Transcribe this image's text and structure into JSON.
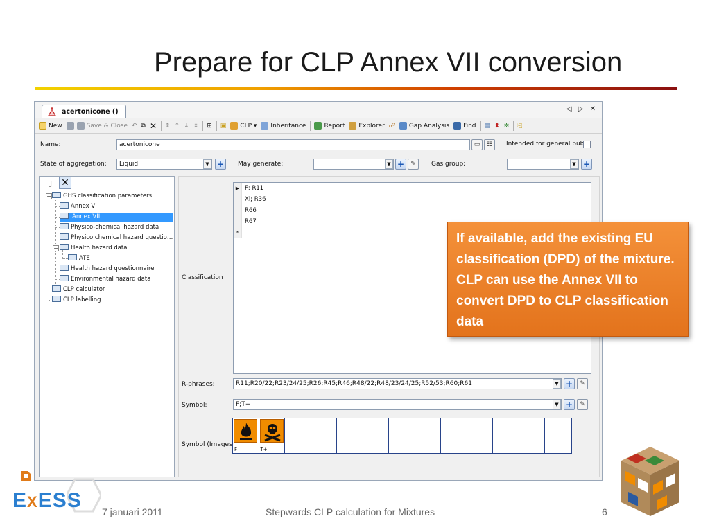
{
  "slide": {
    "title": "Prepare for CLP Annex VII conversion",
    "footer_date": "7 januari 2011",
    "footer_center": "Stepwards CLP calculation for Mixtures",
    "page_number": "6",
    "logo_text": "EXESS",
    "logo_x_color": "#e07b1a",
    "logo_main_color": "#2b7fd0"
  },
  "app": {
    "tab_title": "acertonicone ()",
    "tab_controls": "◁ ▷ ✕",
    "toolbar": [
      {
        "label": "New",
        "icon": "new-icon",
        "enabled": true
      },
      {
        "label": "Save & Close",
        "icon": "save-close-icon",
        "enabled": false
      },
      {
        "label": "CLP",
        "icon": "clp-icon",
        "enabled": true
      },
      {
        "label": "Inheritance",
        "icon": "inheritance-icon",
        "enabled": true
      },
      {
        "label": "Report",
        "icon": "report-icon",
        "enabled": true
      },
      {
        "label": "Explorer",
        "icon": "explorer-icon",
        "enabled": true
      },
      {
        "label": "Gap Analysis",
        "icon": "gap-analysis-icon",
        "enabled": true
      },
      {
        "label": "Find",
        "icon": "find-icon",
        "enabled": true
      }
    ],
    "form": {
      "name_label": "Name:",
      "name_value": "acertonicone",
      "public_label": "Intended for general public",
      "state_label": "State of aggregation:",
      "state_value": "Liquid",
      "may_generate_label": "May generate:",
      "may_generate_value": "",
      "gas_group_label": "Gas group:",
      "gas_group_value": ""
    },
    "tree": [
      {
        "label": "GHS classification parameters",
        "level": 0,
        "expander": "−"
      },
      {
        "label": "Annex VI",
        "level": 1
      },
      {
        "label": "Annex VII",
        "level": 1,
        "selected": true
      },
      {
        "label": "Physico-chemical hazard data",
        "level": 1
      },
      {
        "label": "Physico chemical hazard questio…",
        "level": 1
      },
      {
        "label": "Health hazard data",
        "level": 1,
        "expander": "−"
      },
      {
        "label": "ATE",
        "level": 2
      },
      {
        "label": "Health hazard questionnaire",
        "level": 1
      },
      {
        "label": "Environmental hazard data",
        "level": 1
      },
      {
        "label": "CLP calculator",
        "level": 0
      },
      {
        "label": "CLP labelling",
        "level": 0
      }
    ],
    "classification_label": "Classification",
    "classification_rows": [
      "F; R11",
      "Xi; R36",
      "R66",
      "R67"
    ],
    "new_row_marker": "*",
    "current_row_marker": "▶",
    "r_phrases_label": "R-phrases:",
    "r_phrases_value": "R11;R20/22;R23/24/25;R26;R45;R46;R48/22;R48/23/24/25;R52/53;R60;R61",
    "symbol_label": "Symbol:",
    "symbol_value": "F;T+",
    "symbol_images_label": "Symbol (Images):",
    "symbol_images": [
      {
        "code": "F",
        "icon": "flame-pictogram-icon"
      },
      {
        "code": "T+",
        "icon": "skull-crossbones-pictogram-icon"
      }
    ]
  },
  "callout": {
    "text": "If available, add the existing EU classification (DPD) of the mixture. CLP can use the Annex VII to convert DPD to CLP classification data"
  }
}
